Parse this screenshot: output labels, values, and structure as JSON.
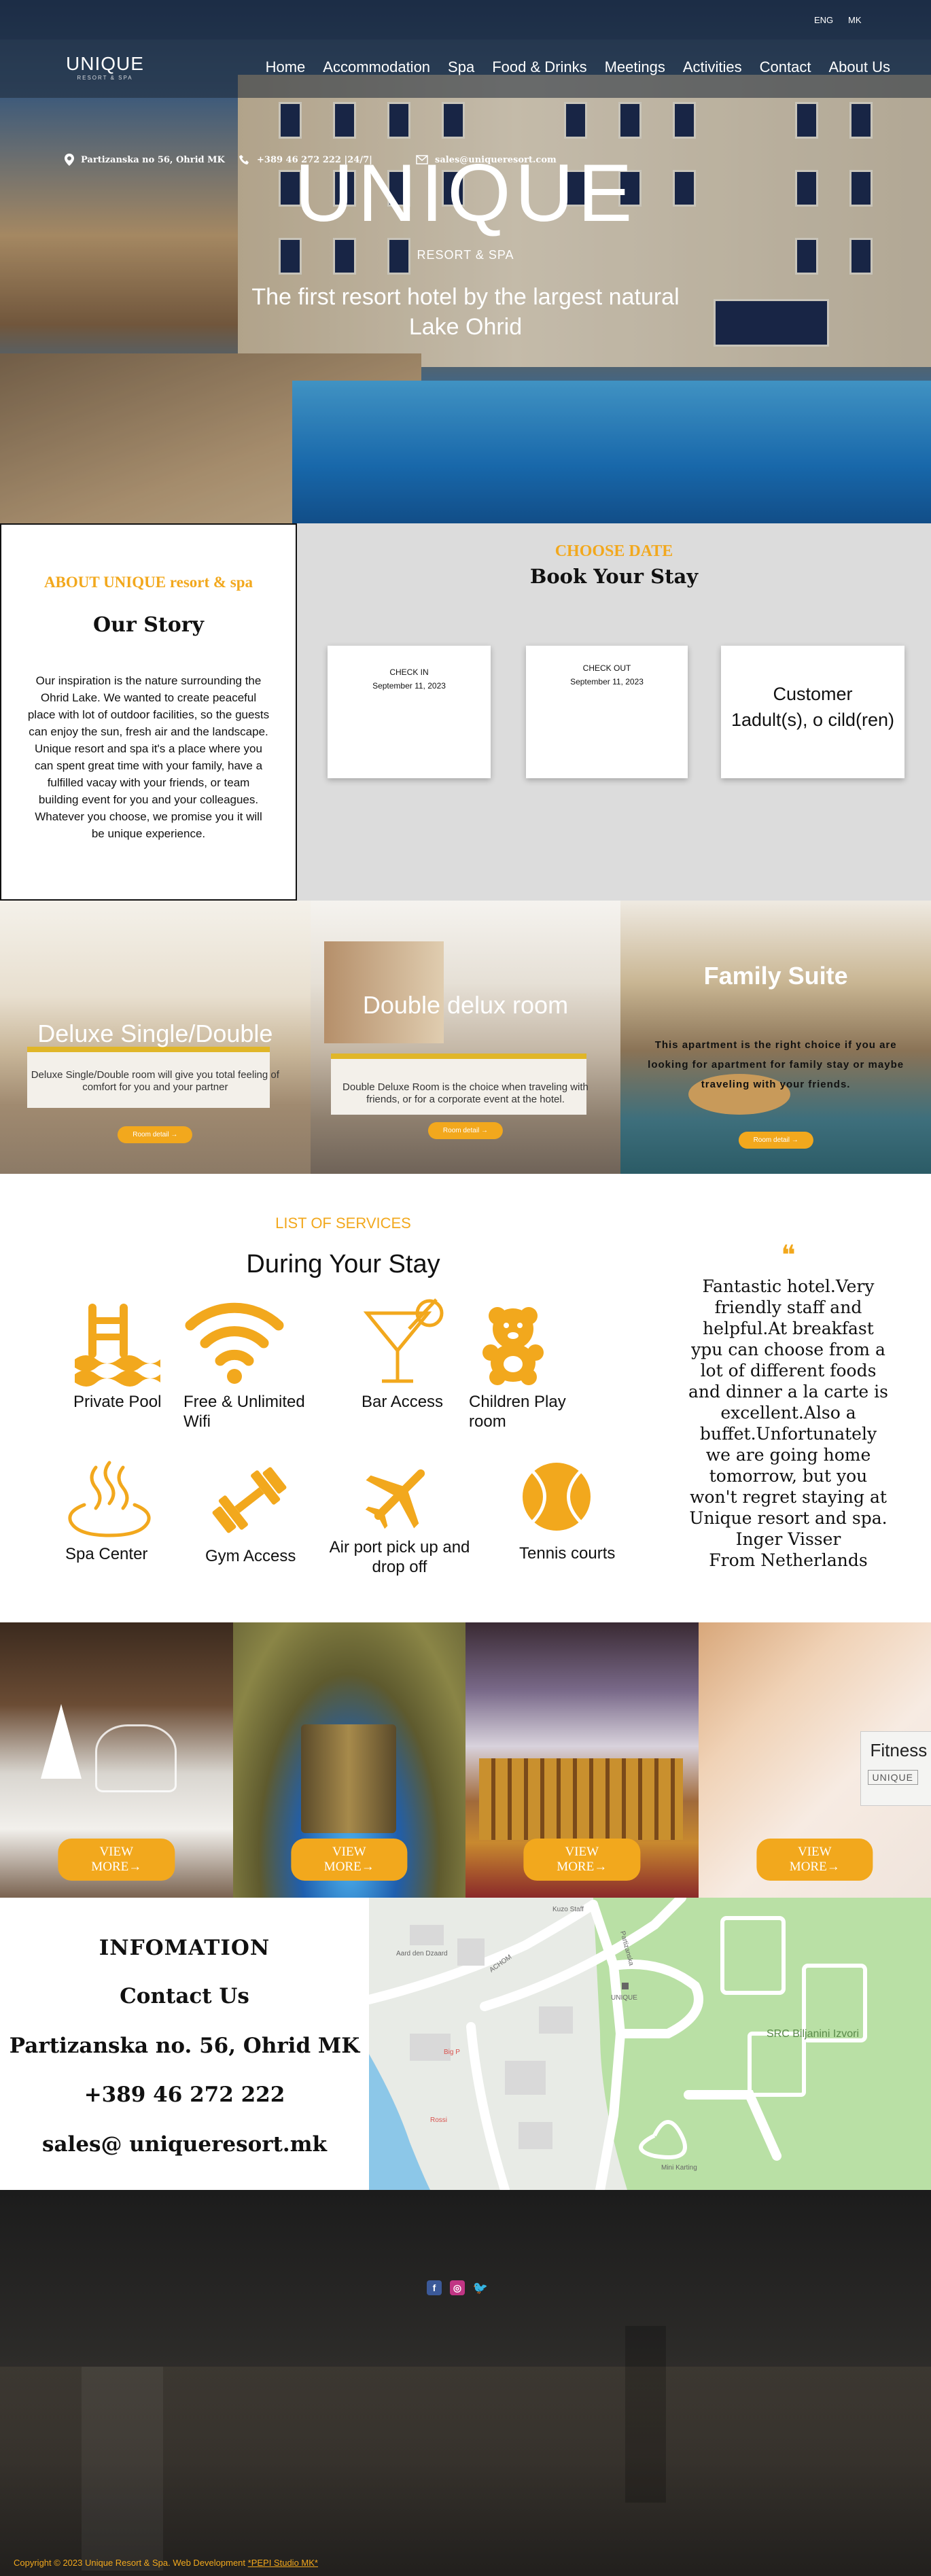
{
  "topbar": {
    "address": "Partizanska no 56, Ohrid MK",
    "phone": "+389 46 272 222 |24/7|",
    "email": "sales@uniqueresort.com",
    "lang_en": "ENG",
    "lang_mk": "MK"
  },
  "brand": {
    "logo": "UNIQUE",
    "logo_tag": "RESORT & SPA",
    "hero_logo": "UNIQUE",
    "hero_sub": "RESORT & SPA",
    "hero_tagline": "The first resort hotel by the largest natural Lake Ohrid"
  },
  "nav": [
    "Home",
    "Accommodation",
    "Spa",
    "Food & Drinks",
    "Meetings",
    "Activities",
    "Contact",
    "About Us"
  ],
  "story": {
    "kicker": "ABOUT UNIQUE resort & spa",
    "title": "Our Story",
    "text": "Our inspiration is the nature surrounding the Ohrid Lake. We wanted to create peaceful place with lot of outdoor facilities, so the guests can enjoy the sun, fresh air and the landscape. Unique resort and spa it's a place where you can spent great time with your family, have a fulfilled vacay with your friends, or team building event for you and your colleagues. Whatever you choose, we promise you it will be unique experience."
  },
  "booking": {
    "kicker": "CHOOSE DATE",
    "title": "Book Your Stay",
    "checkin_label": "CHECK IN",
    "checkin_date": "September 11, 2023",
    "checkout_label": "CHECK OUT",
    "checkout_date": "September 11, 2023",
    "customer_label": "Customer",
    "customer_value": "1adult(s), o cild(ren)"
  },
  "rooms": [
    {
      "title": "Deluxe Single/Double",
      "desc": "Deluxe Single/Double room will give you total feeling of comfort for you and your partner",
      "button": "Room detail →"
    },
    {
      "title": "Double delux room",
      "desc": "Double Deluxe Room is the choice when traveling with friends, or for a corporate event at the hotel.",
      "button": "Room detail →"
    },
    {
      "title": "Family Suite",
      "desc": "This apartment is the right choice if you are looking for apartment for family stay or maybe traveling with your friends.",
      "button": "Room detail →"
    }
  ],
  "services": {
    "kicker": "LIST OF SERVICES",
    "title": "During Your Stay",
    "items": [
      {
        "label": "Private Pool",
        "icon": "pool-ladder-icon"
      },
      {
        "label": "Free & Unlimited Wifi",
        "icon": "wifi-icon"
      },
      {
        "label": "Bar Access",
        "icon": "cocktail-icon"
      },
      {
        "label": "Children Play room",
        "icon": "teddy-bear-icon"
      },
      {
        "label": "Spa Center",
        "icon": "hot-spring-icon"
      },
      {
        "label": "Gym Access",
        "icon": "dumbbell-icon"
      },
      {
        "label": "Air port pick up and drop off",
        "icon": "airplane-icon"
      },
      {
        "label": "Tennis courts",
        "icon": "tennis-ball-icon"
      }
    ]
  },
  "review": {
    "quote_mark": "❝",
    "text": "Fantastic hotel.Very friendly staff and helpful.At breakfast ypu can choose from a lot of different foods and dinner a la carte is excellent.Also a buffet.Unfortunately we are going home tomorrow, but you won't regret staying at Unique resort and spa.",
    "author": "Inger Visser",
    "origin": "From Netherlands"
  },
  "gallery": [
    {
      "button": "VIEW MORE→"
    },
    {
      "button": "VIEW MORE→"
    },
    {
      "button": "VIEW MORE→"
    },
    {
      "button": "VIEW MORE→",
      "sign": "Fitness",
      "sign2": "UNIQUE"
    }
  ],
  "contact": {
    "heading": "INFOMATION",
    "subheading": "Contact Us",
    "address": "Partizanska no. 56, Ohrid MK",
    "phone": "+389 46 272 222",
    "email": "sales@ uniqueresort.mk"
  },
  "map": {
    "labels": [
      "Aard den Dzaard",
      "ACHOM",
      "Kuzo Staff",
      "Partizanska",
      "UNIQUE",
      "Big P",
      "Rossi",
      "SRC Biljanini Izvori",
      "Mini Karting"
    ]
  },
  "footer": {
    "copyright": "Copyright © 2023 Unique Resort & Spa. Web Development ",
    "studio": "*PEPI Studio MK*"
  },
  "colors": {
    "accent": "#f2a81d"
  }
}
